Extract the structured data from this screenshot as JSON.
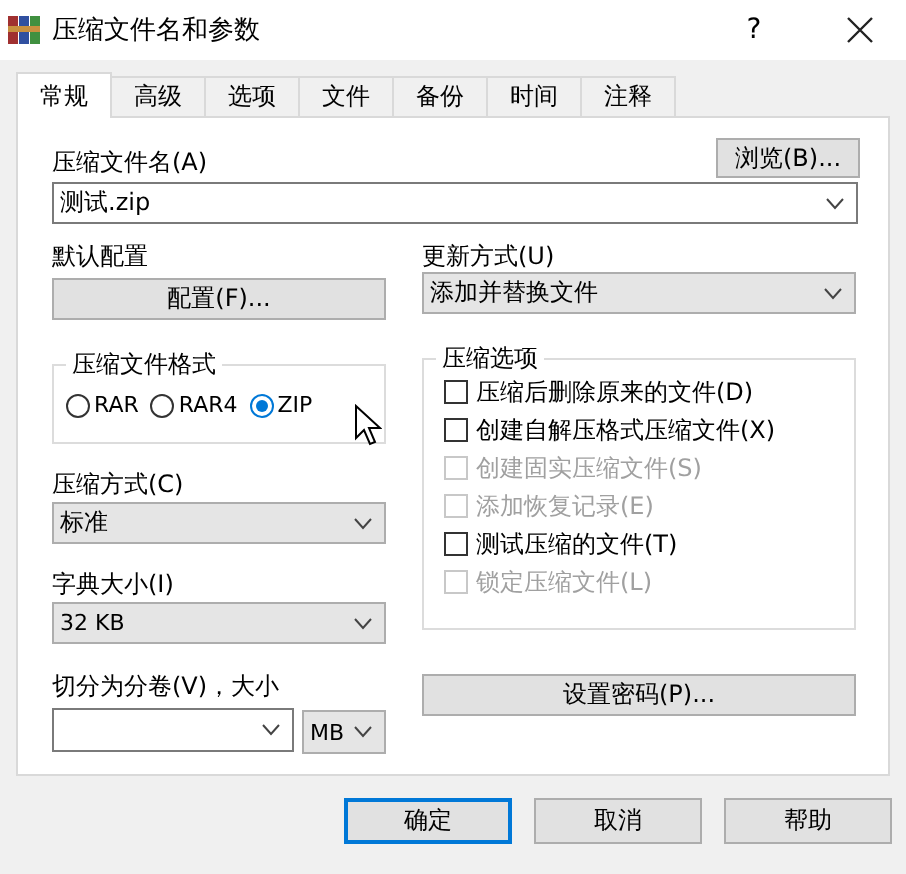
{
  "window": {
    "title": "压缩文件名和参数",
    "help": "?"
  },
  "tabs": [
    {
      "label": "常规",
      "selected": true
    },
    {
      "label": "高级",
      "selected": false
    },
    {
      "label": "选项",
      "selected": false
    },
    {
      "label": "文件",
      "selected": false
    },
    {
      "label": "备份",
      "selected": false
    },
    {
      "label": "时间",
      "selected": false
    },
    {
      "label": "注释",
      "selected": false
    }
  ],
  "archive_name": {
    "label": "压缩文件名(A)",
    "browse_button": "浏览(B)...",
    "value": "测试.zip"
  },
  "default_profile": {
    "label": "默认配置",
    "button": "配置(F)..."
  },
  "update_mode": {
    "label": "更新方式(U)",
    "value": "添加并替换文件"
  },
  "archive_format": {
    "title": "压缩文件格式",
    "options": [
      {
        "label": "RAR",
        "selected": false
      },
      {
        "label": "RAR4",
        "selected": false
      },
      {
        "label": "ZIP",
        "selected": true
      }
    ]
  },
  "compression_method": {
    "label": "压缩方式(C)",
    "value": "标准"
  },
  "dictionary_size": {
    "label": "字典大小(I)",
    "value": "32 KB"
  },
  "split_volumes": {
    "label": "切分为分卷(V)，大小",
    "unit": "MB"
  },
  "archive_options": {
    "title": "压缩选项",
    "items": [
      {
        "label": "压缩后删除原来的文件(D)",
        "checked": false,
        "disabled": false
      },
      {
        "label": "创建自解压格式压缩文件(X)",
        "checked": false,
        "disabled": false
      },
      {
        "label": "创建固实压缩文件(S)",
        "checked": false,
        "disabled": true
      },
      {
        "label": "添加恢复记录(E)",
        "checked": false,
        "disabled": true
      },
      {
        "label": "测试压缩的文件(T)",
        "checked": false,
        "disabled": false
      },
      {
        "label": "锁定压缩文件(L)",
        "checked": false,
        "disabled": true
      }
    ]
  },
  "password_button": "设置密码(P)...",
  "buttons": [
    {
      "label": "确定",
      "default": true
    },
    {
      "label": "取消",
      "default": false
    },
    {
      "label": "帮助",
      "default": false
    }
  ]
}
